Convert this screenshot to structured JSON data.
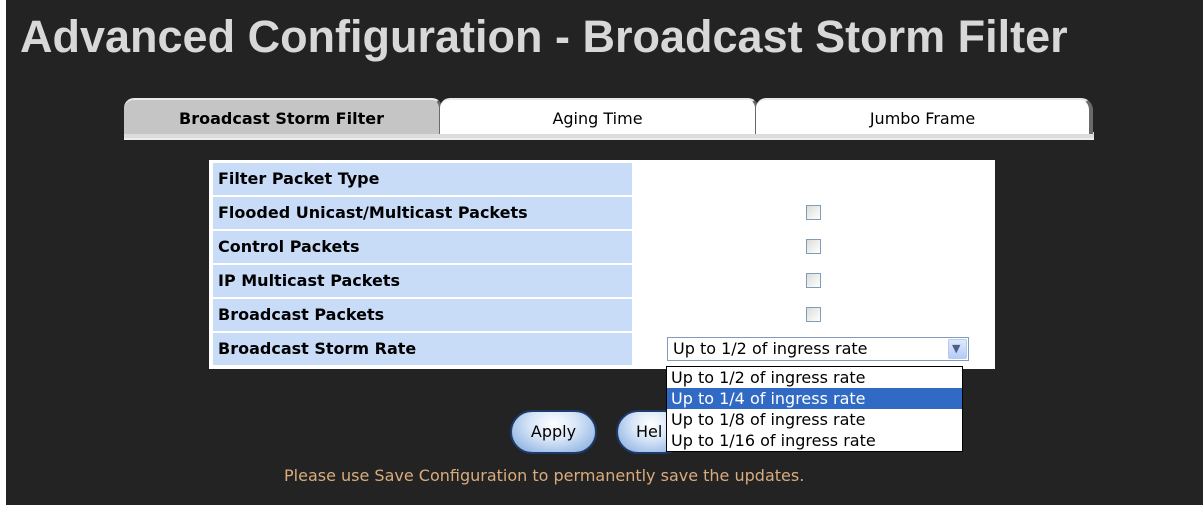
{
  "page": {
    "title": "Advanced Configuration - Broadcast Storm Filter"
  },
  "tabs": [
    {
      "label": "Broadcast Storm Filter",
      "active": true
    },
    {
      "label": "Aging Time",
      "active": false
    },
    {
      "label": "Jumbo Frame",
      "active": false
    }
  ],
  "table": {
    "header_label": "Filter Packet Type",
    "rows": [
      {
        "label": "Flooded Unicast/Multicast Packets",
        "checked": false
      },
      {
        "label": "Control Packets",
        "checked": false
      },
      {
        "label": "IP Multicast Packets",
        "checked": false
      },
      {
        "label": "Broadcast Packets",
        "checked": false
      }
    ],
    "rate": {
      "label": "Broadcast Storm Rate",
      "selected": "Up to 1/2 of ingress rate",
      "options": [
        "Up to 1/2 of ingress rate",
        "Up to 1/4 of ingress rate",
        "Up to 1/8 of ingress rate",
        "Up to 1/16 of ingress rate"
      ],
      "highlighted_option": "Up to 1/4 of ingress rate"
    }
  },
  "buttons": {
    "apply": "Apply",
    "help": "Hel"
  },
  "note": "Please use Save Configuration to permanently save the updates.",
  "icons": {
    "select_arrow": "chevron-down-icon"
  },
  "colors": {
    "background": "#232323",
    "label_cell": "#c8dcf8",
    "note_text": "#d9ac7e",
    "highlight": "#316ac5"
  }
}
